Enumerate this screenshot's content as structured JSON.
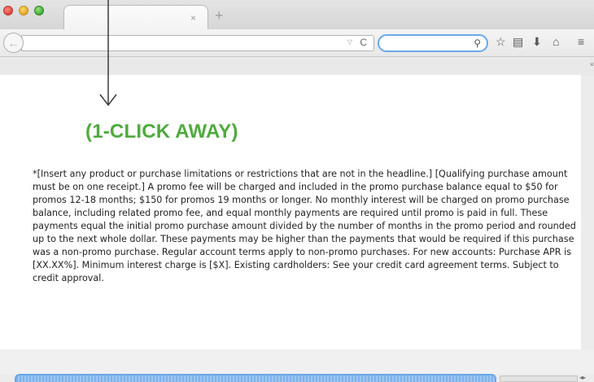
{
  "tabs": [
    {
      "title": "",
      "close_label": "×"
    }
  ],
  "new_tab_label": "+",
  "toolbar": {
    "back_glyph": "←",
    "url": {
      "value": "",
      "placeholder": ""
    },
    "url_dropdown_glyph": "▽",
    "reload_glyph": "C",
    "search": {
      "value": "",
      "placeholder": ""
    },
    "search_glyph": "⚲",
    "icons": [
      "star-icon",
      "bookmarks-icon",
      "download-icon",
      "home-icon",
      "menu-icon"
    ],
    "icon_glyphs": {
      "star": "☆",
      "bookmarks": "▤",
      "download": "⬇",
      "home": "⌂",
      "menu": "≡"
    }
  },
  "band_close_glyph": "×",
  "page": {
    "cta": "(1-CLICK AWAY)",
    "cta_color": "#4faa3e",
    "disclaimer": "*[Insert any product or purchase limitations or restrictions that are not in the headline.] [Qualifying purchase amount must be on one receipt.] A promo fee will be charged and included in the promo purchase balance equal to $50 for promos 12-18 months; $150 for promos 19 months or longer. No monthly interest will be charged on promo purchase balance, including related promo fee, and equal monthly payments are required until promo is paid in full. These payments equal the initial promo purchase amount divided by the number of months in the promo period and rounded up to the next whole dollar. These payments may be higher than the payments that would be required if this purchase was a non-promo purchase. Regular account terms apply to non-promo purchases. For new accounts: Purchase APR is [XX.XX%]. Minimum interest charge is [$X]. Existing cardholders: See your credit card agreement terms. Subject to credit approval."
  },
  "scroll_arrows_glyph": "◂▸"
}
